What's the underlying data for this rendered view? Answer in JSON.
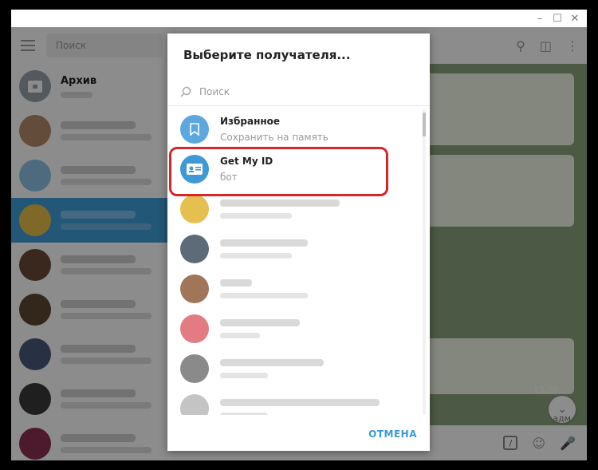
{
  "window": {
    "minimize": "–",
    "maximize": "☐",
    "close": "✕"
  },
  "left": {
    "search_placeholder": "Поиск",
    "archive_title": "Архив"
  },
  "right": {
    "time": "13:28",
    "sender": "адм"
  },
  "dialog": {
    "title": "Выберите получателя...",
    "search_placeholder": "Поиск",
    "items": [
      {
        "name": "Избранное",
        "sub": "Сохранить на память",
        "color": "#5ba7de"
      },
      {
        "name": "Get My ID",
        "sub": "бот",
        "color": "#3d9ad6"
      }
    ],
    "cancel": "ОТМЕНА"
  },
  "colors": {
    "accent": "#3a9ad9",
    "highlight": "#d7262a",
    "selected_chat": "#419fd9"
  }
}
